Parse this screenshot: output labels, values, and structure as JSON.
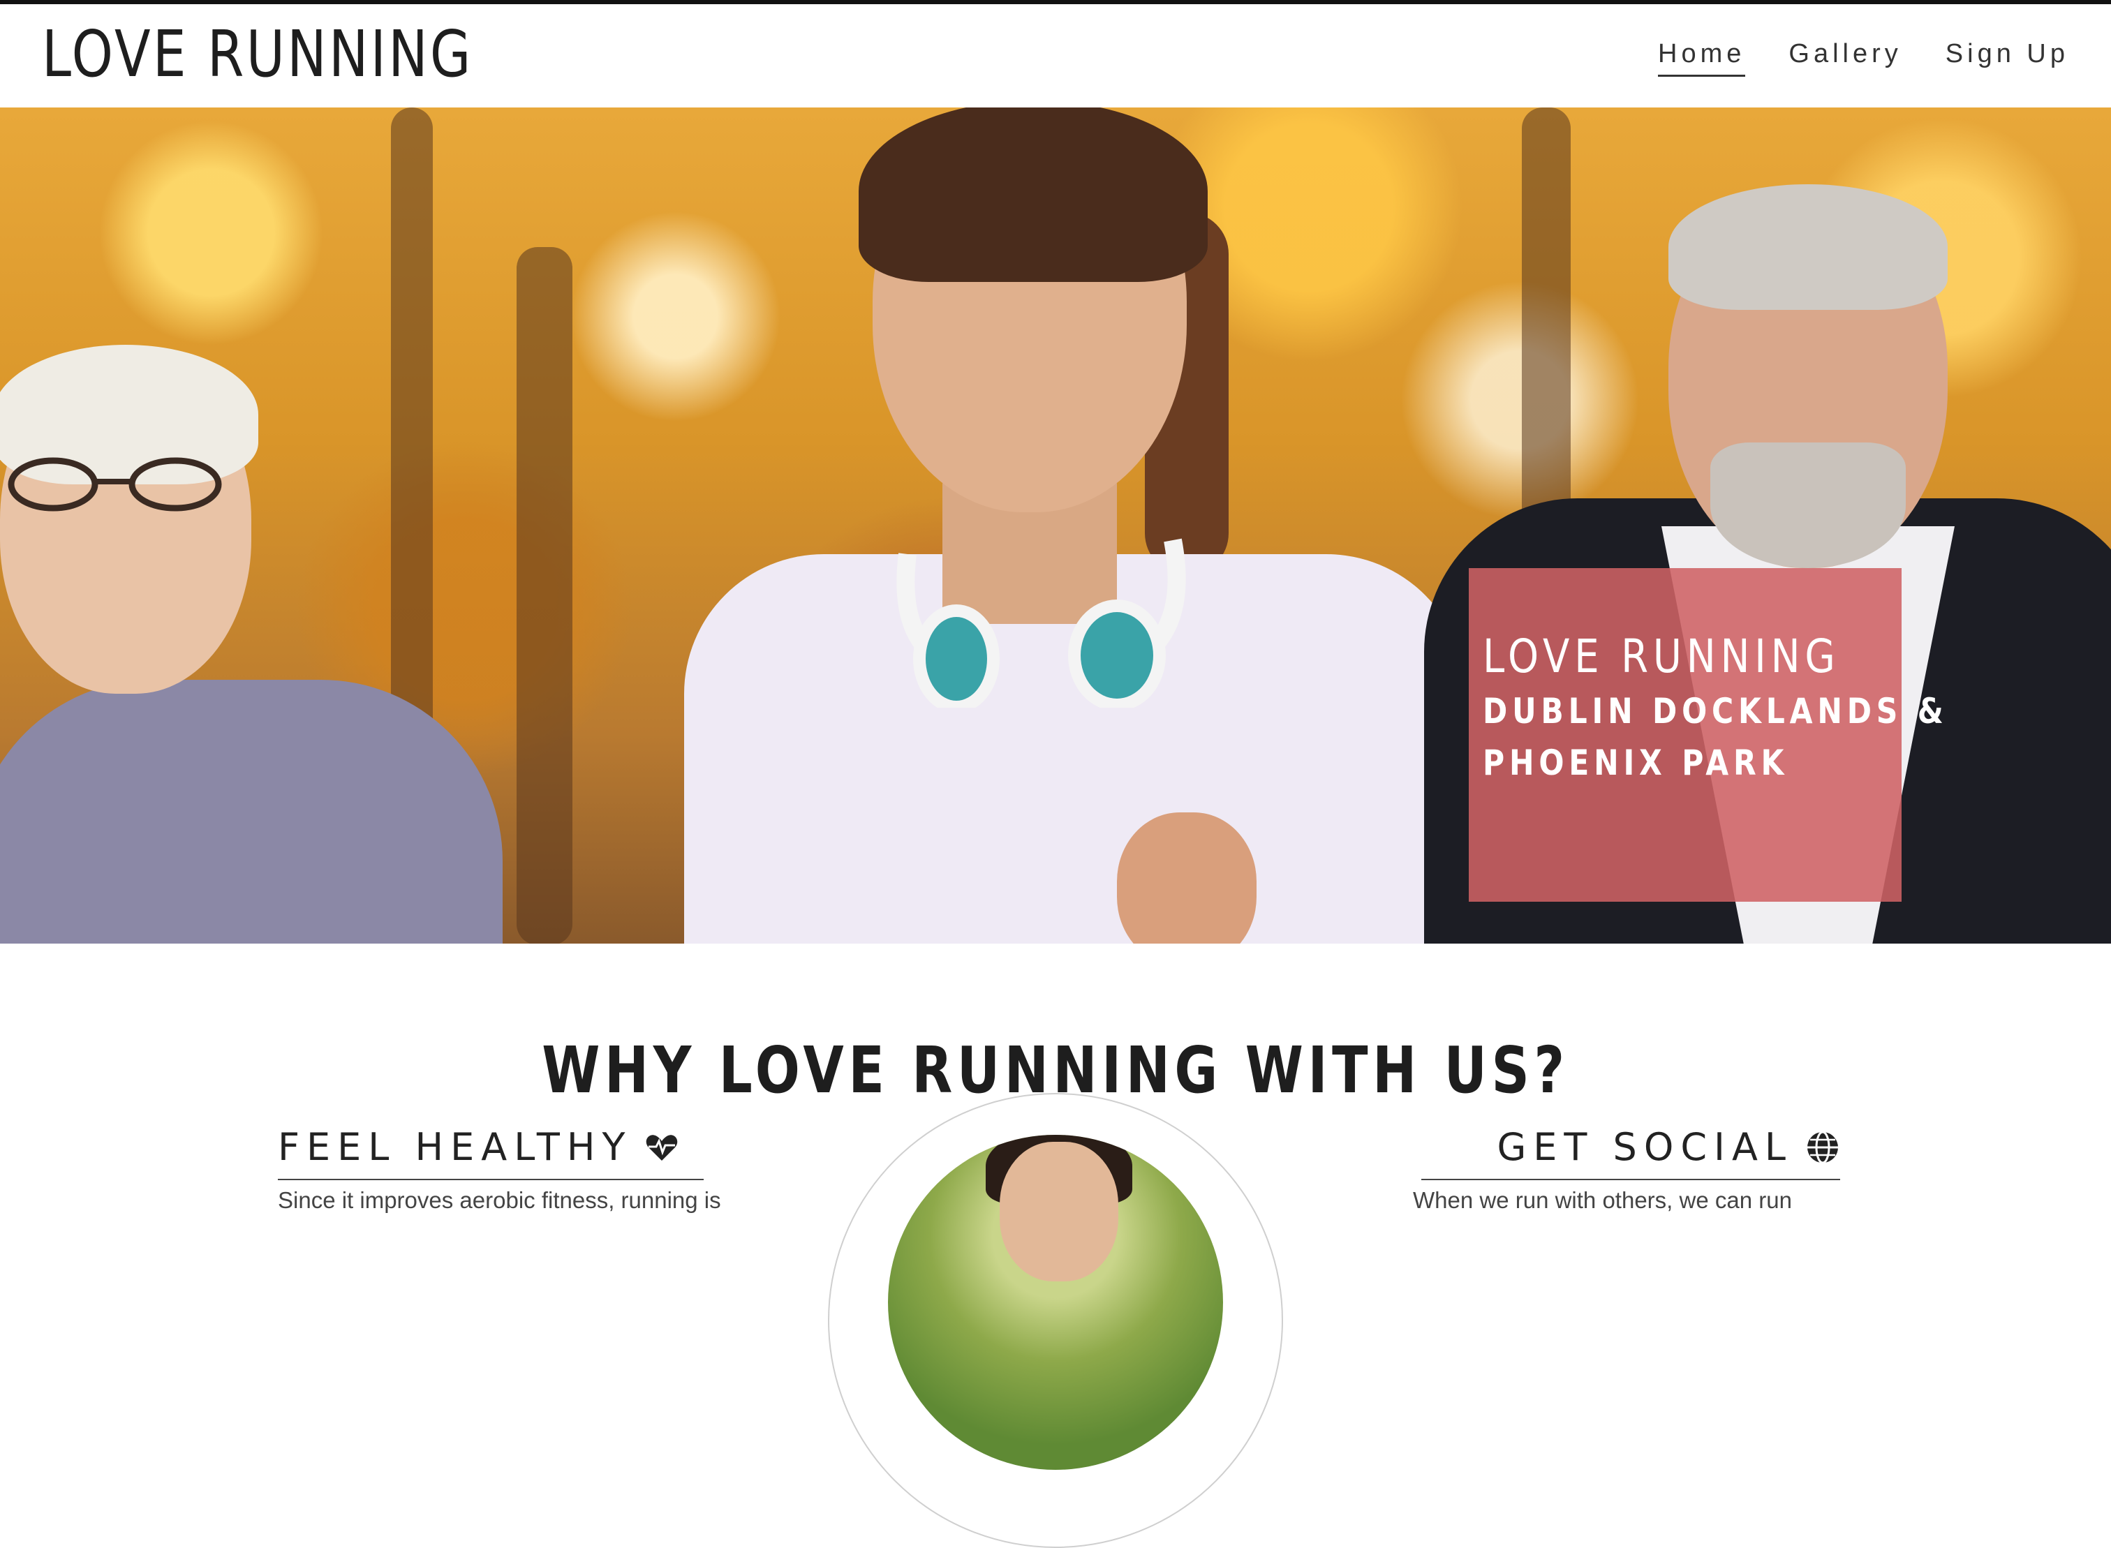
{
  "header": {
    "logo": "LOVE RUNNING",
    "nav": [
      {
        "label": "Home",
        "active": true
      },
      {
        "label": "Gallery",
        "active": false
      },
      {
        "label": "Sign Up",
        "active": false
      }
    ]
  },
  "hero": {
    "card_title": "LOVE RUNNING",
    "card_line1": "DUBLIN DOCKLANDS &",
    "card_line2": "PHOENIX PARK",
    "card_color": "#ce6264"
  },
  "section": {
    "title": "WHY LOVE RUNNING WITH US?"
  },
  "features": {
    "left": {
      "heading": "FEEL HEALTHY",
      "icon": "heartbeat-icon",
      "text": "Since it improves aerobic fitness, running is"
    },
    "right": {
      "heading": "GET SOCIAL",
      "icon": "globe-icon",
      "text": "When we run with others, we can run"
    }
  }
}
